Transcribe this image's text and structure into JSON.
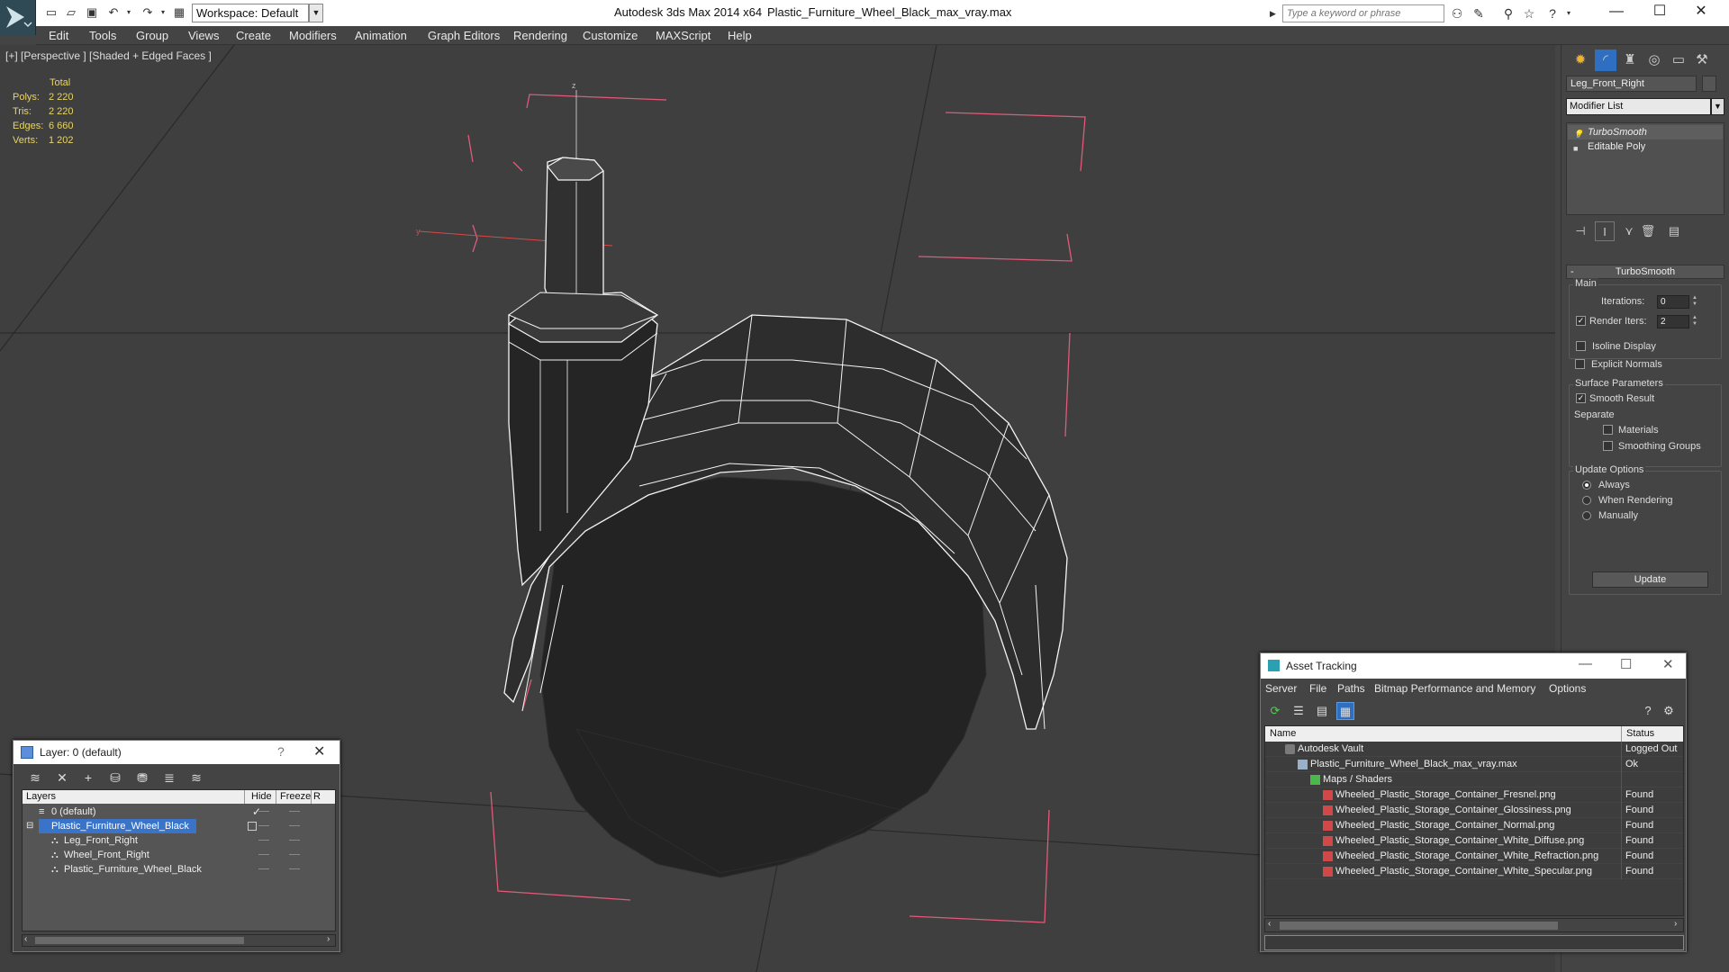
{
  "titlebar": {
    "workspace": "Workspace: Default",
    "app_title": "Autodesk 3ds Max  2014 x64",
    "file_title": "Plastic_Furniture_Wheel_Black_max_vray.max",
    "search_placeholder": "Type a keyword or phrase"
  },
  "menubar": [
    "Edit",
    "Tools",
    "Group",
    "Views",
    "Create",
    "Modifiers",
    "Animation",
    "Graph Editors",
    "Rendering",
    "Customize",
    "MAXScript",
    "Help"
  ],
  "viewport": {
    "label": "[+] [Perspective ] [Shaded + Edged Faces ]",
    "stats_header": "Total",
    "stats": [
      {
        "label": "Polys:",
        "value": "2 220"
      },
      {
        "label": "Tris:",
        "value": "2 220"
      },
      {
        "label": "Edges:",
        "value": "6 660"
      },
      {
        "label": "Verts:",
        "value": "1 202"
      }
    ],
    "axis_z": "z",
    "axis_y": "y"
  },
  "command_panel": {
    "object_name": "Leg_Front_Right",
    "modifier_list": "Modifier List",
    "stack": [
      "TurboSmooth",
      "Editable Poly"
    ],
    "rollout_title": "TurboSmooth",
    "main_group": "Main",
    "iterations_label": "Iterations:",
    "iterations_value": "0",
    "render_iters_label": "Render Iters:",
    "render_iters_value": "2",
    "isoline_label": "Isoline Display",
    "explicit_normals_label": "Explicit Normals",
    "surface_group": "Surface Parameters",
    "smooth_result_label": "Smooth Result",
    "separate_label": "Separate",
    "materials_label": "Materials",
    "smoothing_groups_label": "Smoothing Groups",
    "update_group": "Update Options",
    "always_label": "Always",
    "when_rendering_label": "When Rendering",
    "manually_label": "Manually",
    "update_button": "Update"
  },
  "layer_window": {
    "title": "Layer: 0 (default)",
    "help": "?",
    "columns": [
      "Layers",
      "Hide",
      "Freeze",
      "R"
    ],
    "rows": [
      {
        "name": "0 (default)"
      },
      {
        "name": "Plastic_Furniture_Wheel_Black"
      },
      {
        "name": "Leg_Front_Right"
      },
      {
        "name": "Wheel_Front_Right"
      },
      {
        "name": "Plastic_Furniture_Wheel_Black"
      }
    ]
  },
  "asset_tracking": {
    "title": "Asset Tracking",
    "menu": [
      "Server",
      "File",
      "Paths",
      "Bitmap Performance and Memory",
      "Options"
    ],
    "columns": [
      "Name",
      "Status"
    ],
    "rows": [
      {
        "name": "Autodesk Vault",
        "status": "Logged Out"
      },
      {
        "name": "Plastic_Furniture_Wheel_Black_max_vray.max",
        "status": "Ok"
      },
      {
        "name": "Maps / Shaders",
        "status": ""
      },
      {
        "name": "Wheeled_Plastic_Storage_Container_Fresnel.png",
        "status": "Found"
      },
      {
        "name": "Wheeled_Plastic_Storage_Container_Glossiness.png",
        "status": "Found"
      },
      {
        "name": "Wheeled_Plastic_Storage_Container_Normal.png",
        "status": "Found"
      },
      {
        "name": "Wheeled_Plastic_Storage_Container_White_Diffuse.png",
        "status": "Found"
      },
      {
        "name": "Wheeled_Plastic_Storage_Container_White_Refraction.png",
        "status": "Found"
      },
      {
        "name": "Wheeled_Plastic_Storage_Container_White_Specular.png",
        "status": "Found"
      }
    ]
  },
  "colors": {
    "selection": "#3a74c8",
    "bounding_box": "#e05a7a",
    "stats_text": "#e8d46a",
    "viewport_bg": "#3f3f3f"
  }
}
